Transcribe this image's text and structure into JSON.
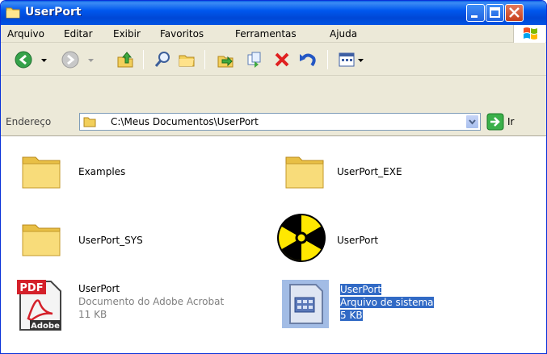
{
  "window": {
    "title": "UserPort",
    "title_icon": "folder-icon"
  },
  "menu": {
    "items": [
      "Arquivo",
      "Editar",
      "Exibir",
      "Favoritos",
      "Ferramentas",
      "Ajuda"
    ]
  },
  "toolbar": {
    "tools": [
      "back-icon",
      "back-dropdown-icon",
      "forward-icon",
      "forward-dropdown-icon",
      "up-folder-icon",
      "search-icon",
      "folders-icon",
      "move-to-icon",
      "copy-to-icon",
      "delete-icon",
      "undo-icon",
      "views-icon"
    ]
  },
  "address": {
    "label": "Endereço",
    "path": "C:\\Meus Documentos\\UserPort",
    "go_label": "Ir"
  },
  "files": [
    {
      "name": "Examples",
      "type": "folder"
    },
    {
      "name": "UserPort_EXE",
      "type": "folder"
    },
    {
      "name": "UserPort_SYS",
      "type": "folder"
    },
    {
      "name": "UserPort",
      "type": "executable",
      "icon": "radiation-icon"
    },
    {
      "name": "UserPort",
      "type": "pdf",
      "description": "Documento do Adobe Acrobat",
      "size": "11 KB",
      "icon_text": "PDF",
      "icon_brand": "Adobe"
    },
    {
      "name": "UserPort",
      "type": "system-file",
      "description": "Arquivo de sistema",
      "size": "5 KB",
      "selected": true
    }
  ],
  "colors": {
    "titlebar": "#0054e3",
    "selection": "#316ac5",
    "folder": "#f5d66a",
    "pdf_red": "#d4202a",
    "radiation_yellow": "#ffe800"
  }
}
